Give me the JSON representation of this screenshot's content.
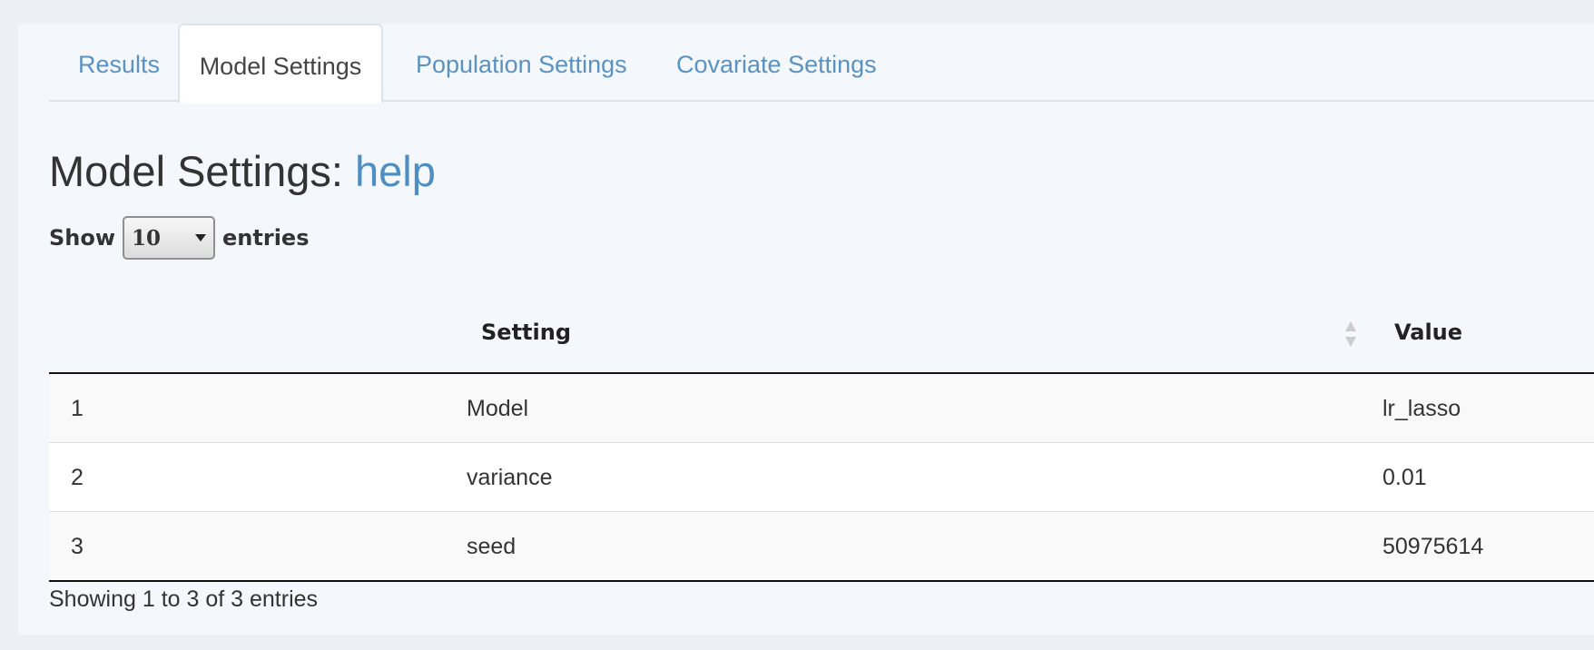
{
  "tabs": [
    {
      "label": "Results",
      "active": false
    },
    {
      "label": "Model Settings",
      "active": true
    },
    {
      "label": "Population Settings",
      "active": false
    },
    {
      "label": "Covariate Settings",
      "active": false
    }
  ],
  "heading": {
    "title": "Model Settings:",
    "help_link": "help"
  },
  "length_menu": {
    "show_label": "Show",
    "selected": "10",
    "entries_label": "entries"
  },
  "table": {
    "columns": [
      "",
      "Setting",
      "Value"
    ],
    "rows": [
      [
        "1",
        "Model",
        "lr_lasso"
      ],
      [
        "2",
        "variance",
        "0.01"
      ],
      [
        "3",
        "seed",
        "50975614"
      ]
    ]
  },
  "footer": {
    "info": "Showing 1 to 3 of 3 entries"
  },
  "icons": {
    "sort": "sort-icon",
    "dropdown": "caret-down-icon"
  },
  "colors": {
    "link": "#5a92c2",
    "page_bg": "#ecf0f5",
    "panel_bg": "#f4f7fb"
  }
}
